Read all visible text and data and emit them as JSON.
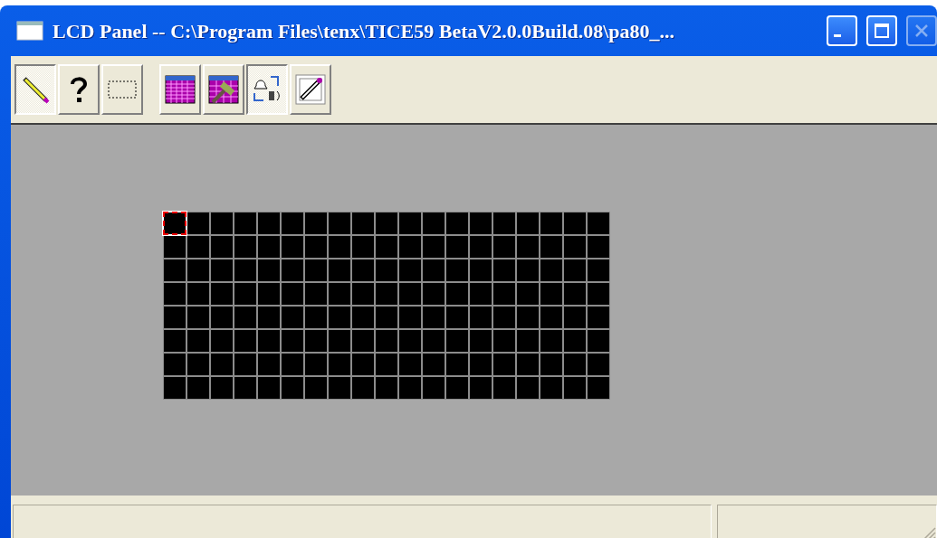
{
  "window": {
    "title": "LCD Panel -- C:\\Program Files\\tenx\\TICE59 BetaV2.0.0Build.08\\pa80_..."
  },
  "toolbar": {
    "buttons": [
      {
        "kind": "pencil",
        "pressed": true
      },
      {
        "kind": "help",
        "pressed": false
      },
      {
        "kind": "select",
        "pressed": false
      },
      {
        "kind": "grid",
        "pressed": false
      },
      {
        "kind": "grid-hammer",
        "pressed": false
      },
      {
        "kind": "bell-speaker",
        "pressed": true
      },
      {
        "kind": "pencil-frame",
        "pressed": false
      }
    ]
  },
  "lcd": {
    "rows": [
      [
        {
          "selected": true
        },
        {
          "selected": false
        },
        {
          "selected": false
        },
        {
          "selected": false
        },
        {
          "selected": false
        },
        {
          "selected": false
        },
        {
          "selected": false
        },
        {
          "selected": false
        },
        {
          "selected": false
        },
        {
          "selected": false
        },
        {
          "selected": false
        },
        {
          "selected": false
        },
        {
          "selected": false
        },
        {
          "selected": false
        },
        {
          "selected": false
        },
        {
          "selected": false
        },
        {
          "selected": false
        },
        {
          "selected": false
        },
        {
          "selected": false
        }
      ],
      [
        {
          "selected": false
        },
        {
          "selected": false
        },
        {
          "selected": false
        },
        {
          "selected": false
        },
        {
          "selected": false
        },
        {
          "selected": false
        },
        {
          "selected": false
        },
        {
          "selected": false
        },
        {
          "selected": false
        },
        {
          "selected": false
        },
        {
          "selected": false
        },
        {
          "selected": false
        },
        {
          "selected": false
        },
        {
          "selected": false
        },
        {
          "selected": false
        },
        {
          "selected": false
        },
        {
          "selected": false
        },
        {
          "selected": false
        },
        {
          "selected": false
        }
      ],
      [
        {
          "selected": false
        },
        {
          "selected": false
        },
        {
          "selected": false
        },
        {
          "selected": false
        },
        {
          "selected": false
        },
        {
          "selected": false
        },
        {
          "selected": false
        },
        {
          "selected": false
        },
        {
          "selected": false
        },
        {
          "selected": false
        },
        {
          "selected": false
        },
        {
          "selected": false
        },
        {
          "selected": false
        },
        {
          "selected": false
        },
        {
          "selected": false
        },
        {
          "selected": false
        },
        {
          "selected": false
        },
        {
          "selected": false
        },
        {
          "selected": false
        }
      ],
      [
        {
          "selected": false
        },
        {
          "selected": false
        },
        {
          "selected": false
        },
        {
          "selected": false
        },
        {
          "selected": false
        },
        {
          "selected": false
        },
        {
          "selected": false
        },
        {
          "selected": false
        },
        {
          "selected": false
        },
        {
          "selected": false
        },
        {
          "selected": false
        },
        {
          "selected": false
        },
        {
          "selected": false
        },
        {
          "selected": false
        },
        {
          "selected": false
        },
        {
          "selected": false
        },
        {
          "selected": false
        },
        {
          "selected": false
        },
        {
          "selected": false
        }
      ],
      [
        {
          "selected": false
        },
        {
          "selected": false
        },
        {
          "selected": false
        },
        {
          "selected": false
        },
        {
          "selected": false
        },
        {
          "selected": false
        },
        {
          "selected": false
        },
        {
          "selected": false
        },
        {
          "selected": false
        },
        {
          "selected": false
        },
        {
          "selected": false
        },
        {
          "selected": false
        },
        {
          "selected": false
        },
        {
          "selected": false
        },
        {
          "selected": false
        },
        {
          "selected": false
        },
        {
          "selected": false
        },
        {
          "selected": false
        },
        {
          "selected": false
        }
      ],
      [
        {
          "selected": false
        },
        {
          "selected": false
        },
        {
          "selected": false
        },
        {
          "selected": false
        },
        {
          "selected": false
        },
        {
          "selected": false
        },
        {
          "selected": false
        },
        {
          "selected": false
        },
        {
          "selected": false
        },
        {
          "selected": false
        },
        {
          "selected": false
        },
        {
          "selected": false
        },
        {
          "selected": false
        },
        {
          "selected": false
        },
        {
          "selected": false
        },
        {
          "selected": false
        },
        {
          "selected": false
        },
        {
          "selected": false
        },
        {
          "selected": false
        }
      ],
      [
        {
          "selected": false
        },
        {
          "selected": false
        },
        {
          "selected": false
        },
        {
          "selected": false
        },
        {
          "selected": false
        },
        {
          "selected": false
        },
        {
          "selected": false
        },
        {
          "selected": false
        },
        {
          "selected": false
        },
        {
          "selected": false
        },
        {
          "selected": false
        },
        {
          "selected": false
        },
        {
          "selected": false
        },
        {
          "selected": false
        },
        {
          "selected": false
        },
        {
          "selected": false
        },
        {
          "selected": false
        },
        {
          "selected": false
        },
        {
          "selected": false
        }
      ],
      [
        {
          "selected": false
        },
        {
          "selected": false
        },
        {
          "selected": false
        },
        {
          "selected": false
        },
        {
          "selected": false
        },
        {
          "selected": false
        },
        {
          "selected": false
        },
        {
          "selected": false
        },
        {
          "selected": false
        },
        {
          "selected": false
        },
        {
          "selected": false
        },
        {
          "selected": false
        },
        {
          "selected": false
        },
        {
          "selected": false
        },
        {
          "selected": false
        },
        {
          "selected": false
        },
        {
          "selected": false
        },
        {
          "selected": false
        },
        {
          "selected": false
        }
      ]
    ]
  }
}
